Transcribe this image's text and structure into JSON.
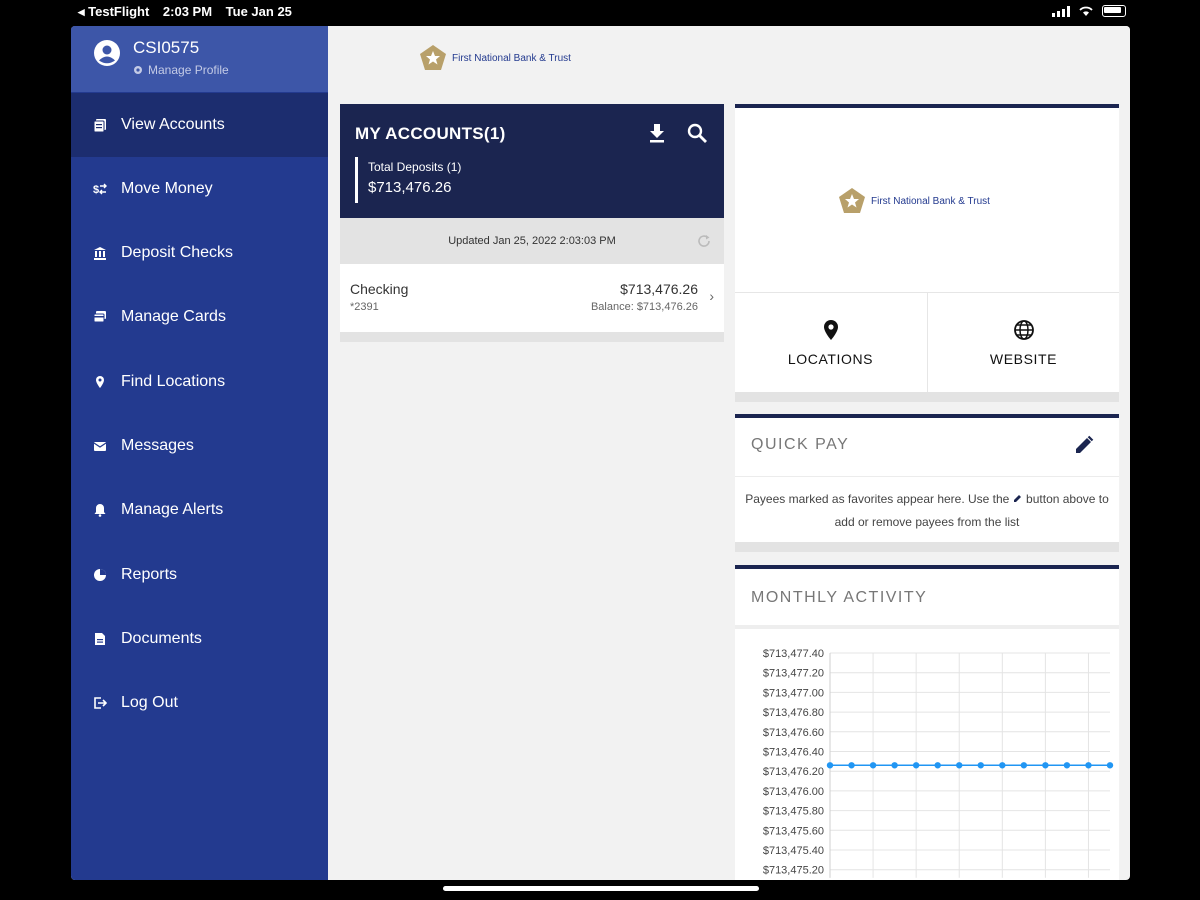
{
  "status_bar": {
    "back_app": "◂ TestFlight",
    "time": "2:03 PM",
    "date": "Tue Jan 25"
  },
  "profile": {
    "username": "CSI0575",
    "manage_label": "Manage Profile"
  },
  "sidebar": {
    "items": [
      {
        "label": "View Accounts",
        "icon": "accounts-icon",
        "active": true
      },
      {
        "label": "Move Money",
        "icon": "money-transfer-icon"
      },
      {
        "label": "Deposit Checks",
        "icon": "bank-icon"
      },
      {
        "label": "Manage Cards",
        "icon": "card-icon"
      },
      {
        "label": "Find Locations",
        "icon": "location-pin-icon"
      },
      {
        "label": "Messages",
        "icon": "envelope-icon"
      },
      {
        "label": "Manage Alerts",
        "icon": "bell-icon"
      },
      {
        "label": "Reports",
        "icon": "pie-chart-icon"
      },
      {
        "label": "Documents",
        "icon": "document-icon"
      },
      {
        "label": "Log Out",
        "icon": "logout-icon"
      }
    ]
  },
  "brand": {
    "name": "First National Bank & Trust"
  },
  "accounts": {
    "title": "MY ACCOUNTS(1)",
    "total_label": "Total Deposits (1)",
    "total_amount": "$713,476.26",
    "updated": "Updated Jan 25, 2022 2:03:03 PM",
    "rows": [
      {
        "name": "Checking",
        "number": "*2391",
        "balance": "$713,476.26",
        "available": "Balance: $713,476.26"
      }
    ]
  },
  "links": {
    "locations": "LOCATIONS",
    "website": "WEBSITE"
  },
  "quick_pay": {
    "title": "QUICK PAY",
    "msg_part1": "Payees marked as favorites appear here. Use the",
    "msg_part2": "button above to add or remove payees from the list"
  },
  "monthly_activity": {
    "title": "MONTHLY ACTIVITY"
  },
  "colors": {
    "sidebar": "#233a8f",
    "header": "#1b2550",
    "line": "#2196f3",
    "gold": "#b8a06a"
  },
  "chart_data": {
    "type": "line",
    "title": "MONTHLY ACTIVITY",
    "y_ticks": [
      "$713,477.40",
      "$713,477.20",
      "$713,477.00",
      "$713,476.80",
      "$713,476.60",
      "$713,476.40",
      "$713,476.20",
      "$713,476.00",
      "$713,475.80",
      "$713,475.60",
      "$713,475.40",
      "$713,475.20"
    ],
    "ylim": [
      713475.2,
      713477.4
    ],
    "series": [
      {
        "values": [
          713476.26,
          713476.26,
          713476.26,
          713476.26,
          713476.26,
          713476.26,
          713476.26,
          713476.26,
          713476.26,
          713476.26,
          713476.26,
          713476.26,
          713476.26,
          713476.26
        ]
      }
    ],
    "grid": true
  }
}
